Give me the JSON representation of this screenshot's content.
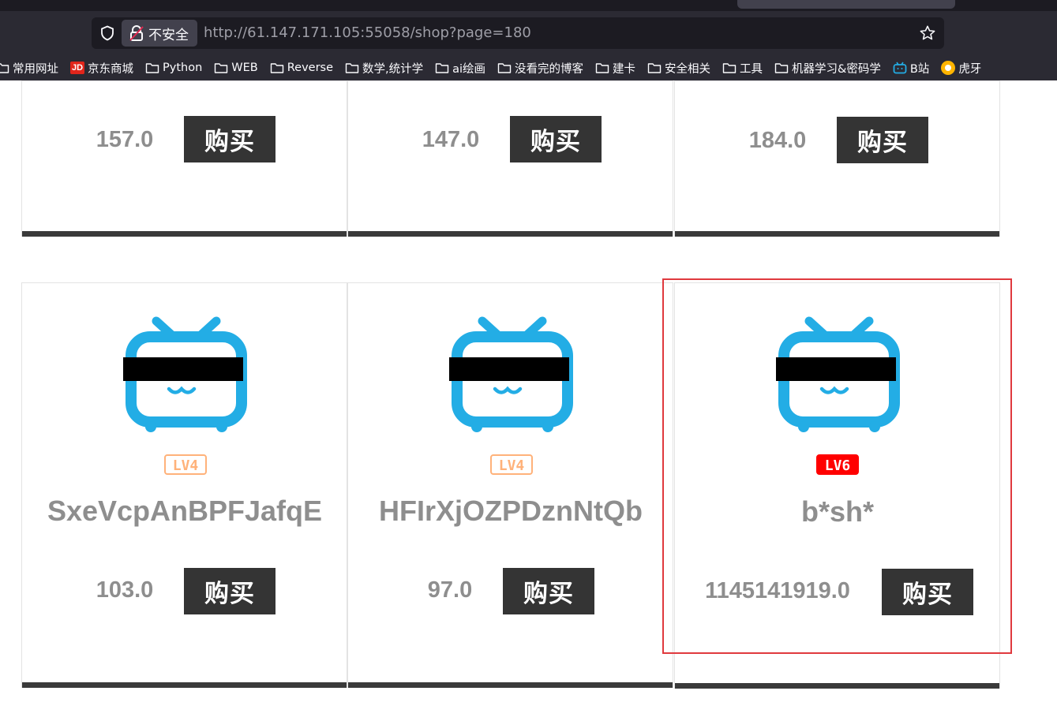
{
  "browser": {
    "security_label": "不安全",
    "url_host": "http://61.147.171.105",
    "url_rest": ":55058/shop?page=180",
    "bookmarks": [
      {
        "label": "常用网址",
        "icon": "folder-icon"
      },
      {
        "label": "京东商城",
        "icon": "jd-icon",
        "badge": "JD"
      },
      {
        "label": "Python",
        "icon": "folder-icon"
      },
      {
        "label": "WEB",
        "icon": "folder-icon"
      },
      {
        "label": "Reverse",
        "icon": "folder-icon"
      },
      {
        "label": "数学,统计学",
        "icon": "folder-icon"
      },
      {
        "label": "ai绘画",
        "icon": "folder-icon"
      },
      {
        "label": "没看完的博客",
        "icon": "folder-icon"
      },
      {
        "label": "建卡",
        "icon": "folder-icon"
      },
      {
        "label": "安全相关",
        "icon": "folder-icon"
      },
      {
        "label": "工具",
        "icon": "folder-icon"
      },
      {
        "label": "机器学习&密码学",
        "icon": "folder-icon"
      },
      {
        "label": "B站",
        "icon": "bilibili-icon"
      },
      {
        "label": "虎牙",
        "icon": "huya-icon"
      }
    ]
  },
  "shop": {
    "buy_label": "购买",
    "top_row": [
      {
        "price": "157.0"
      },
      {
        "price": "147.0"
      },
      {
        "price": "184.0"
      }
    ],
    "bottom_row": [
      {
        "name": "SxeVcpAnBPFJafqE",
        "level": "LV4",
        "level_color": "#ffb27a",
        "price": "103.0"
      },
      {
        "name": "HFIrXjOZPDznNtQb",
        "level": "LV4",
        "level_color": "#ffb27a",
        "price": "97.0"
      },
      {
        "name": "b*sh*",
        "level": "LV6",
        "level_color": "#ff0000",
        "price": "1145141919.0"
      }
    ]
  },
  "colors": {
    "tv_blue": "#23ade5",
    "button_bg": "#343434",
    "highlight": "#e0393e"
  }
}
